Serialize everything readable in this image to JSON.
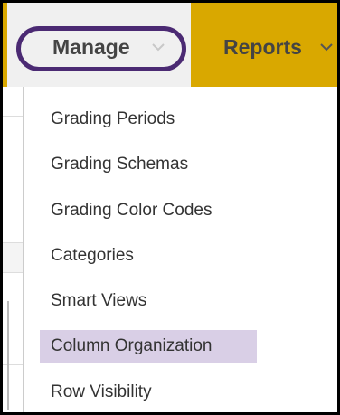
{
  "nav": {
    "manage_label": "Manage",
    "reports_label": "Reports",
    "manage_icon": "chevron-down-icon",
    "reports_icon": "chevron-down-icon",
    "colors": {
      "bar": "#d9a800",
      "active_tab": "#f0f0f0",
      "highlight_ring": "#4b2a73"
    }
  },
  "dropdown": {
    "items": [
      {
        "label": "Grading Periods"
      },
      {
        "label": "Grading Schemas"
      },
      {
        "label": "Grading Color Codes"
      },
      {
        "label": "Categories"
      },
      {
        "label": "Smart Views"
      },
      {
        "label": "Column Organization",
        "selected": true
      },
      {
        "label": "Row Visibility"
      }
    ],
    "colors": {
      "selected_background": "#d9cfe6"
    }
  }
}
